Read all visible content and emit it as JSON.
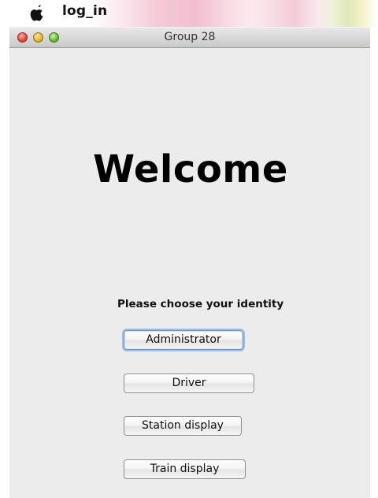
{
  "menubar": {
    "app_name": "log_in",
    "icon": "apple-icon"
  },
  "window": {
    "title": "Group 28",
    "controls": [
      "close-icon",
      "minimize-icon",
      "zoom-icon"
    ]
  },
  "main": {
    "welcome_text": "Welcome",
    "prompt": "Please choose your identity",
    "buttons": {
      "administrator": "Administrator",
      "driver": "Driver",
      "station_display": "Station display",
      "train_display": "Train display"
    },
    "focused_button": "Administrator"
  },
  "colors": {
    "window_background": "#ececec",
    "focus_ring": "#9bbfe6",
    "close": "#e9473c",
    "minimize": "#e8b62b",
    "zoom": "#6cbd3a"
  }
}
